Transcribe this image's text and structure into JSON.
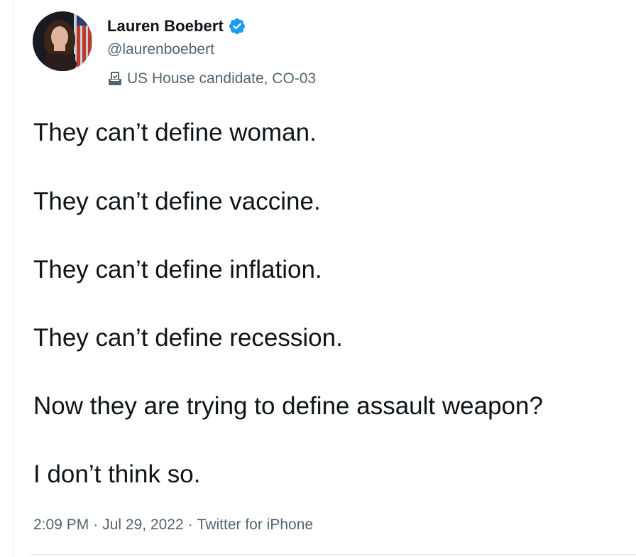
{
  "author": {
    "display_name": "Lauren Boebert",
    "handle": "@laurenboebert",
    "account_label": "US House candidate, CO-03",
    "verified_color": "#1d9bf0",
    "label_icon": "ballot-box-icon"
  },
  "tweet": {
    "lines": [
      "They can’t define woman.",
      "They can’t define vaccine.",
      "They can’t define inflation.",
      "They can’t define recession.",
      "Now they are trying to define assault weapon?",
      "I don’t think so."
    ]
  },
  "meta": {
    "time": "2:09 PM",
    "date": "Jul 29, 2022",
    "source": "Twitter for iPhone",
    "separator": "·"
  }
}
